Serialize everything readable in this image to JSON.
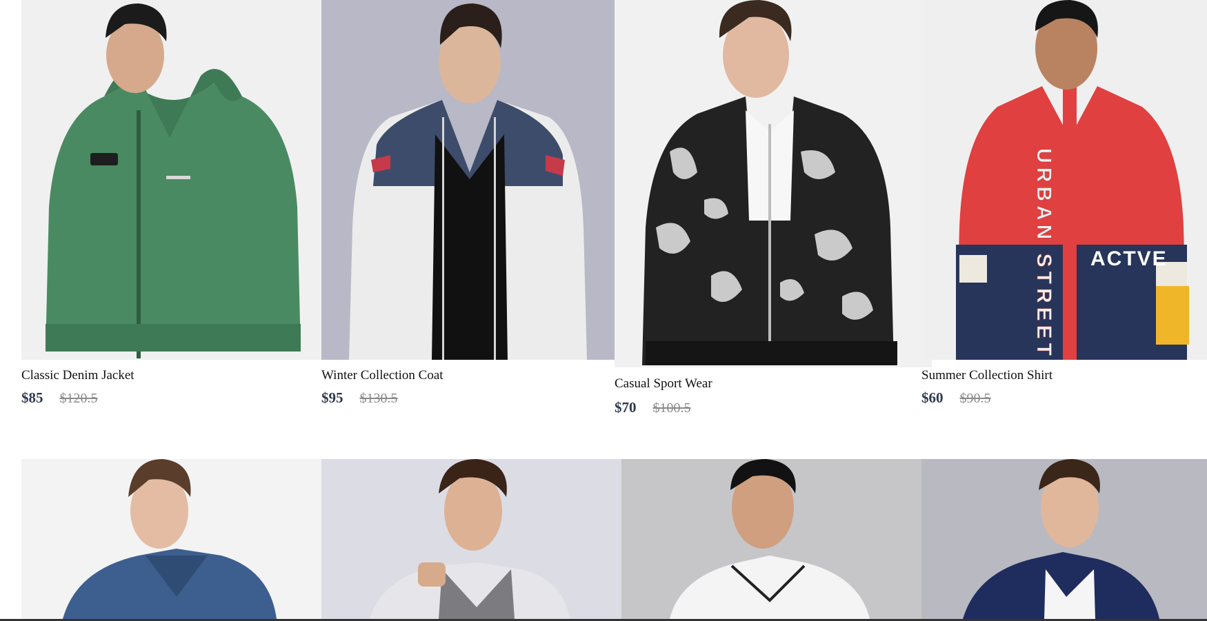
{
  "products": [
    {
      "name": "Classic Denim Jacket",
      "price": "$85",
      "original_price": "$120.5",
      "image": "green-hoodie-jacket"
    },
    {
      "name": "Winter Collection Coat",
      "price": "$95",
      "original_price": "$130.5",
      "image": "white-navy-puffer-jacket"
    },
    {
      "name": "Casual Sport Wear",
      "price": "$70",
      "original_price": "$100.5",
      "image": "black-white-marble-bomber"
    },
    {
      "name": "Summer Collection Shirt",
      "price": "$60",
      "original_price": "$90.5",
      "image": "red-navy-windbreaker"
    },
    {
      "image": "denim-jacket"
    },
    {
      "image": "grey-zip-sweatshirt"
    },
    {
      "image": "white-hooded-jacket"
    },
    {
      "image": "navy-jacket"
    }
  ],
  "image_text": {
    "urban_street": "URBAN STREET",
    "active": "ACTVE"
  },
  "colors": {
    "price": "#2f3a4f",
    "old_price": "#8a8a8a"
  }
}
